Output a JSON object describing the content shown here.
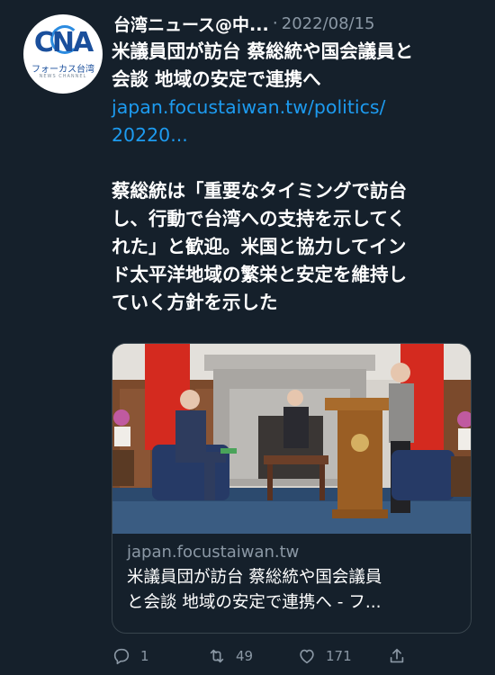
{
  "tweet": {
    "author": "台湾ニュース@中...",
    "separator": "·",
    "date": "2022/08/15",
    "avatar": {
      "logo_text": "CNA",
      "subtitle": "フォーカス台湾",
      "subtitle_en": "NEWS CHANNEL"
    },
    "body_lines": [
      "米議員団が訪台 蔡総統や国会議員と",
      "会談 地域の安定で連携へ"
    ],
    "link_lines": [
      "japan.focustaiwan.tw/politics/",
      "20220..."
    ],
    "quote_lines": [
      "蔡総統は「重要なタイミングで訪台",
      "し、行動で台湾への支持を示してく",
      "れた」と歓迎。米国と協力してイン",
      "ド太平洋地域の繁栄と安定を維持し",
      "ていく方針を示した"
    ]
  },
  "card": {
    "domain": "japan.focustaiwan.tw",
    "title_lines": [
      "米議員団が訪台 蔡総統や国会議員",
      "と会談 地域の安定で連携へ - フ..."
    ]
  },
  "actions": {
    "reply_count": "1",
    "retweet_count": "49",
    "like_count": "171",
    "icons": [
      "reply-icon",
      "retweet-icon",
      "like-icon",
      "share-icon"
    ]
  },
  "colors": {
    "background": "#15202b",
    "link": "#1d9bf0",
    "muted": "#8b98a5",
    "border": "#38444d"
  }
}
